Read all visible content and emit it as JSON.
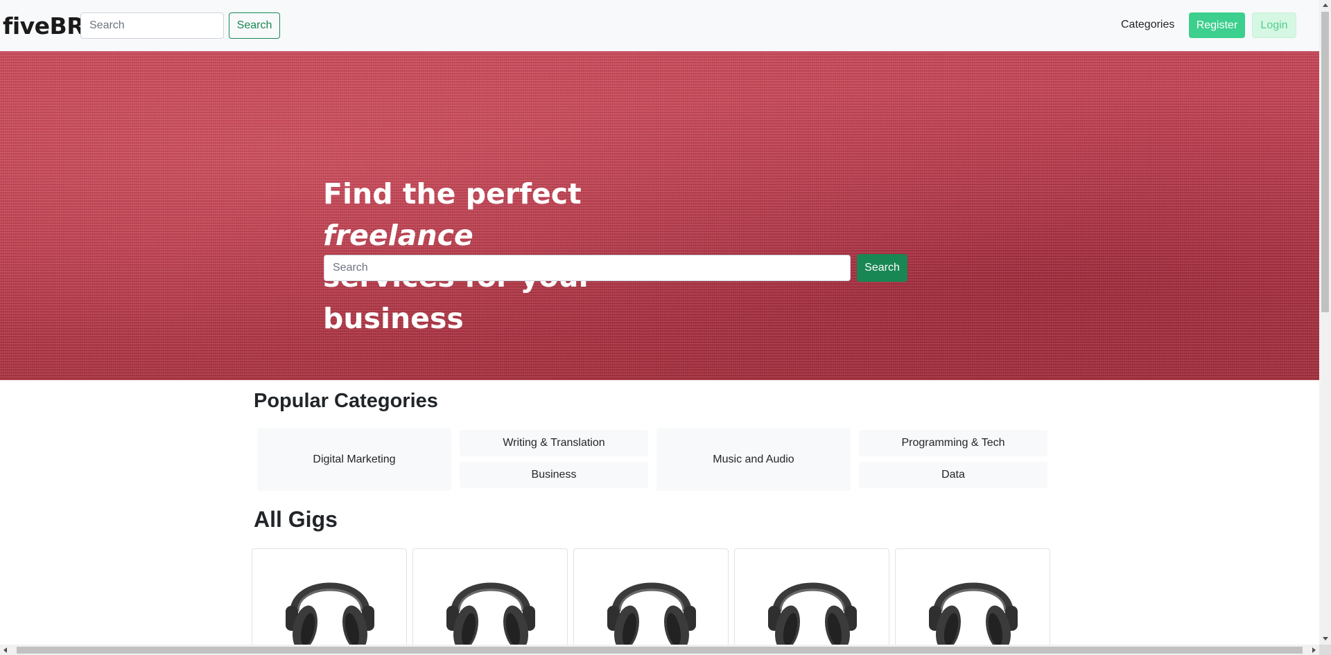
{
  "navbar": {
    "brand": "fiveBR",
    "search_placeholder": "Search",
    "search_button": "Search",
    "categories_link": "Categories",
    "register_button": "Register",
    "login_button": "Login"
  },
  "hero": {
    "title_part1": "Find the perfect ",
    "title_emphasis": "freelance",
    "title_part2": "services for your business",
    "search_placeholder": "Search",
    "search_button": "Search"
  },
  "popular_categories": {
    "title": "Popular Categories",
    "items": [
      {
        "label": "Digital Marketing"
      },
      {
        "label": "Writing & Translation"
      },
      {
        "label": "Business"
      },
      {
        "label": "Music and Audio"
      },
      {
        "label": "Programming & Tech"
      },
      {
        "label": "Data"
      }
    ]
  },
  "gigs": {
    "title": "All Gigs",
    "cards": [
      {
        "image_icon": "headphones-icon"
      },
      {
        "image_icon": "headphones-icon"
      },
      {
        "image_icon": "headphones-icon"
      },
      {
        "image_icon": "headphones-icon"
      },
      {
        "image_icon": "headphones-icon"
      }
    ]
  },
  "colors": {
    "primary_green": "#198754",
    "register_green": "#3ccf8e",
    "login_light_green": "#d6f7e3",
    "hero_red": "#c23a4d",
    "navbar_bg": "#f8f9fa"
  }
}
